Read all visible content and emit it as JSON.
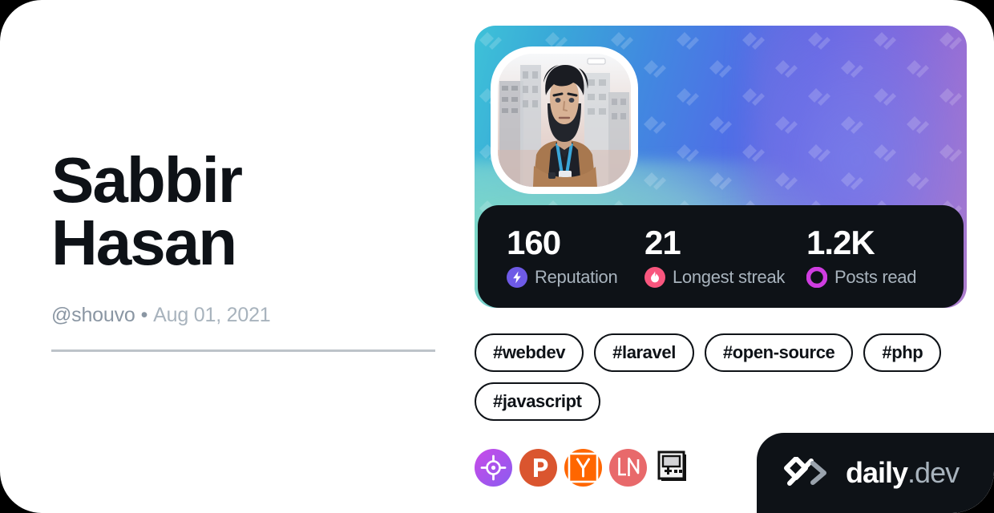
{
  "profile": {
    "display_name": "Sabbir Hasan",
    "username": "@shouvo",
    "separator": "•",
    "joined_date": "Aug 01, 2021"
  },
  "avatar": {
    "alt": "avatar-illustration-man-with-beard-in-city"
  },
  "cover": {
    "pattern_icon": "daily-dev-logo-watermark",
    "gradient_from": "#3ec2d8",
    "gradient_to": "#b07cc9"
  },
  "stats": [
    {
      "value": "160",
      "label": "Reputation",
      "icon": "bolt-icon",
      "color": "#6e5ae6"
    },
    {
      "value": "21",
      "label": "Longest streak",
      "icon": "flame-icon",
      "color": "#f8567e"
    },
    {
      "value": "1.2K",
      "label": "Posts read",
      "icon": "ring-icon",
      "color": "#cf3de0"
    }
  ],
  "tags": [
    "#webdev",
    "#laravel",
    "#open-source",
    "#php",
    "#javascript"
  ],
  "badges": [
    {
      "name": "crosshair-badge-icon",
      "color": "#b44ae8"
    },
    {
      "name": "product-hunt-badge-icon",
      "color": "#da552f"
    },
    {
      "name": "hacker-news-badge-icon",
      "color": "#ff6600"
    },
    {
      "name": "lobsters-ln-badge-icon",
      "color": "#e8696b"
    },
    {
      "name": "retro-console-badge-icon",
      "color": "#111111"
    }
  ],
  "branding": {
    "logo_icon": "daily-dev-chevrons-logo",
    "word_primary": "daily",
    "word_secondary": ".dev"
  },
  "theme": {
    "card_background": "#ffffff",
    "page_background": "#000000",
    "text_primary": "#0e1217",
    "text_secondary": "#8a96a3",
    "dark_surface": "#0e1217",
    "divider": "#bdc3c9"
  }
}
